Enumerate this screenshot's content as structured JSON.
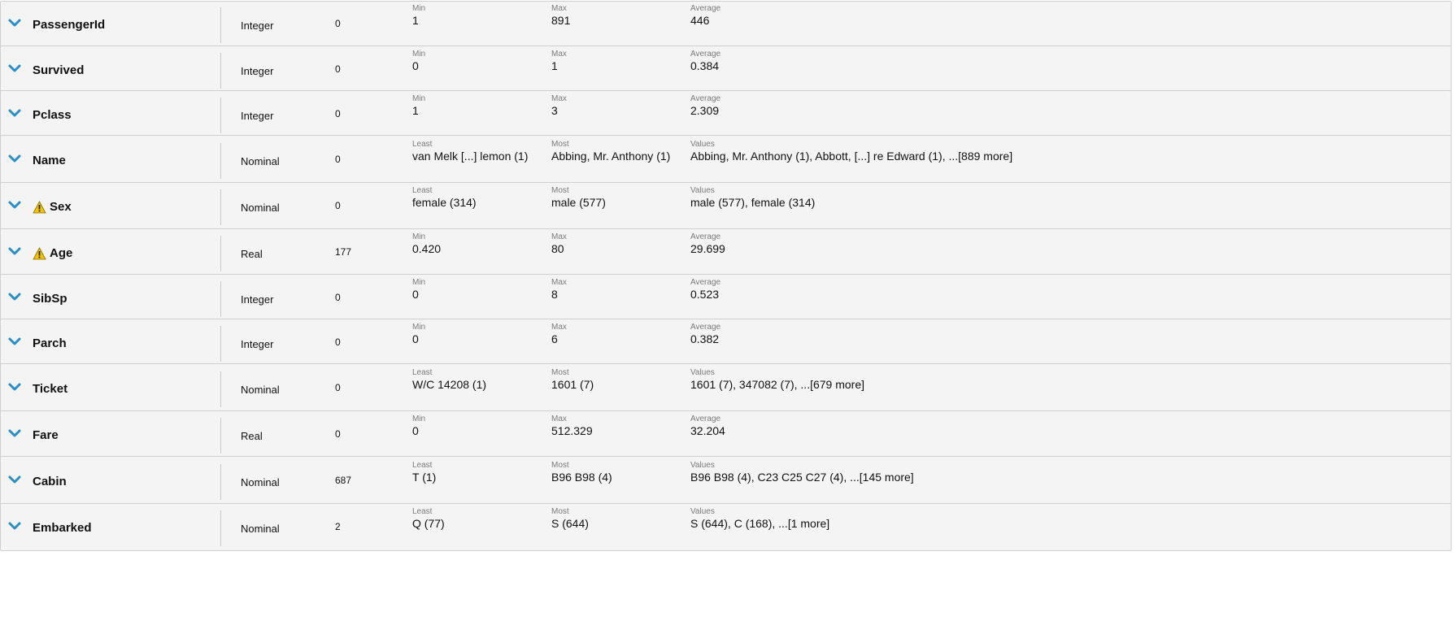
{
  "attributes": [
    {
      "name": "PassengerId",
      "warning": false,
      "type": "Integer",
      "missing": "0",
      "stats": [
        {
          "label": "Min",
          "value": "1"
        },
        {
          "label": "Max",
          "value": "891"
        },
        {
          "label": "Average",
          "value": "446"
        }
      ]
    },
    {
      "name": "Survived",
      "warning": false,
      "type": "Integer",
      "missing": "0",
      "stats": [
        {
          "label": "Min",
          "value": "0"
        },
        {
          "label": "Max",
          "value": "1"
        },
        {
          "label": "Average",
          "value": "0.384"
        }
      ]
    },
    {
      "name": "Pclass",
      "warning": false,
      "type": "Integer",
      "missing": "0",
      "stats": [
        {
          "label": "Min",
          "value": "1"
        },
        {
          "label": "Max",
          "value": "3"
        },
        {
          "label": "Average",
          "value": "2.309"
        }
      ]
    },
    {
      "name": "Name",
      "warning": false,
      "type": "Nominal",
      "missing": "0",
      "stats": [
        {
          "label": "Least",
          "value": "van Melk [...] lemon (1)"
        },
        {
          "label": "Most",
          "value": "Abbing, Mr. Anthony (1)"
        },
        {
          "label": "Values",
          "value": "Abbing, Mr. Anthony (1), Abbott,  [...] re Edward (1), ...[889 more]"
        }
      ]
    },
    {
      "name": "Sex",
      "warning": true,
      "type": "Nominal",
      "missing": "0",
      "stats": [
        {
          "label": "Least",
          "value": "female (314)"
        },
        {
          "label": "Most",
          "value": "male (577)"
        },
        {
          "label": "Values",
          "value": "male (577), female (314)"
        }
      ]
    },
    {
      "name": "Age",
      "warning": true,
      "type": "Real",
      "missing": "177",
      "stats": [
        {
          "label": "Min",
          "value": "0.420"
        },
        {
          "label": "Max",
          "value": "80"
        },
        {
          "label": "Average",
          "value": "29.699"
        }
      ]
    },
    {
      "name": "SibSp",
      "warning": false,
      "type": "Integer",
      "missing": "0",
      "stats": [
        {
          "label": "Min",
          "value": "0"
        },
        {
          "label": "Max",
          "value": "8"
        },
        {
          "label": "Average",
          "value": "0.523"
        }
      ]
    },
    {
      "name": "Parch",
      "warning": false,
      "type": "Integer",
      "missing": "0",
      "stats": [
        {
          "label": "Min",
          "value": "0"
        },
        {
          "label": "Max",
          "value": "6"
        },
        {
          "label": "Average",
          "value": "0.382"
        }
      ]
    },
    {
      "name": "Ticket",
      "warning": false,
      "type": "Nominal",
      "missing": "0",
      "stats": [
        {
          "label": "Least",
          "value": "W/C 14208 (1)"
        },
        {
          "label": "Most",
          "value": "1601 (7)"
        },
        {
          "label": "Values",
          "value": "1601 (7), 347082 (7), ...[679 more]"
        }
      ]
    },
    {
      "name": "Fare",
      "warning": false,
      "type": "Real",
      "missing": "0",
      "stats": [
        {
          "label": "Min",
          "value": "0"
        },
        {
          "label": "Max",
          "value": "512.329"
        },
        {
          "label": "Average",
          "value": "32.204"
        }
      ]
    },
    {
      "name": "Cabin",
      "warning": false,
      "type": "Nominal",
      "missing": "687",
      "stats": [
        {
          "label": "Least",
          "value": "T (1)"
        },
        {
          "label": "Most",
          "value": "B96 B98 (4)"
        },
        {
          "label": "Values",
          "value": "B96 B98 (4), C23 C25 C27 (4), ...[145 more]"
        }
      ]
    },
    {
      "name": "Embarked",
      "warning": false,
      "type": "Nominal",
      "missing": "2",
      "stats": [
        {
          "label": "Least",
          "value": "Q (77)"
        },
        {
          "label": "Most",
          "value": "S (644)"
        },
        {
          "label": "Values",
          "value": "S (644), C (168), ...[1 more]"
        }
      ]
    }
  ],
  "icons": {
    "expand": "chevron-down-icon",
    "warning": "warning-icon"
  },
  "colors": {
    "chevron": "#2a8fc4",
    "warning": "#f2c200",
    "row_bg": "#f4f4f4",
    "row_border": "#cfcfcf"
  }
}
